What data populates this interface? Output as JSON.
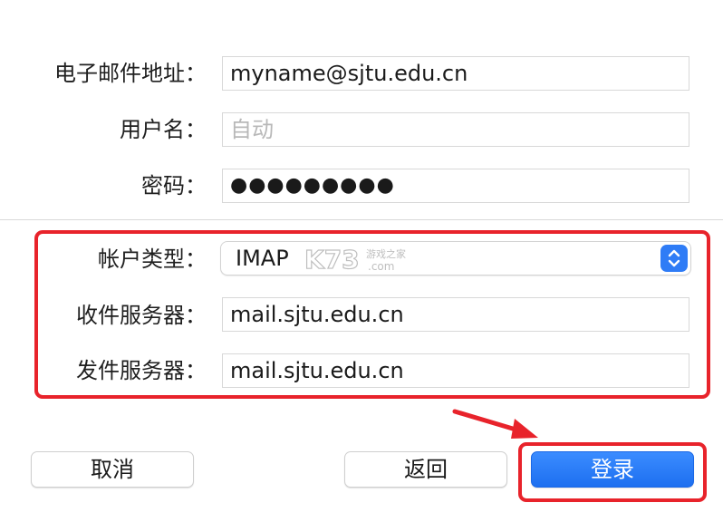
{
  "account_form": {
    "email_label": "电子邮件地址：",
    "email_value": "myname@sjtu.edu.cn",
    "username_label": "用户名：",
    "username_placeholder": "自动",
    "password_label": "密码：",
    "password_value": "●●●●●●●●●",
    "account_type_label": "帐户类型：",
    "account_type_value": "IMAP",
    "incoming_server_label": "收件服务器：",
    "incoming_server_value": "mail.sjtu.edu.cn",
    "outgoing_server_label": "发件服务器：",
    "outgoing_server_value": "mail.sjtu.edu.cn"
  },
  "buttons": {
    "cancel_label": "取消",
    "back_label": "返回",
    "login_label": "登录"
  },
  "watermark": {
    "brand": "K73",
    "cn_text": "游戏之家",
    "domain": ".com"
  },
  "colors": {
    "accent": "#2f7cf6",
    "highlight": "#e8232b"
  }
}
